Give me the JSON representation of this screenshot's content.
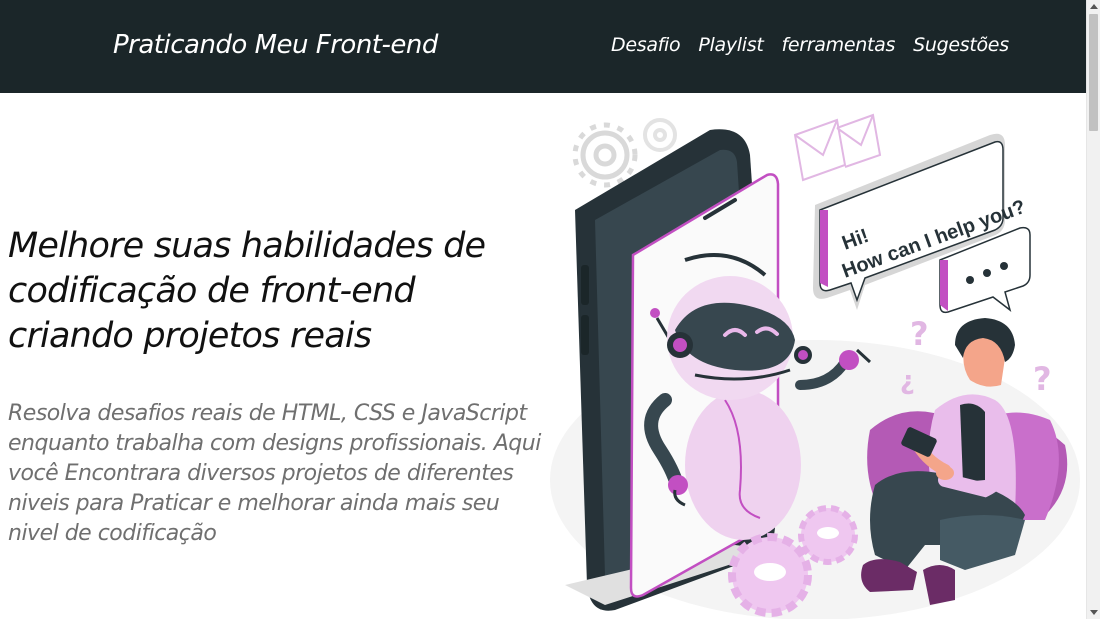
{
  "header": {
    "brand": "Praticando Meu Front-end",
    "nav": [
      "Desafio",
      "Playlist",
      "ferramentas",
      "Sugestões"
    ]
  },
  "hero": {
    "title": "Melhore suas habilidades de codificação de front-end criando projetos reais",
    "description": "Resolva desafios reais de HTML, CSS e JavaScript enquanto trabalha com designs profissionais. Aqui você Encontrara diversos projetos de diferentes niveis para Praticar e melhorar ainda mais seu nivel de codificação"
  },
  "illustration": {
    "speech_bubble_line1": "Hi!",
    "speech_bubble_line2": "How can I help you?",
    "icons": [
      "gear-icon",
      "envelope-icon",
      "question-mark-icon",
      "smartphone-icon",
      "robot-icon"
    ]
  },
  "colors": {
    "header_bg": "#1b2629",
    "accent": "#c24fc2",
    "accent_light": "#ebc6ec",
    "dark": "#263238"
  }
}
